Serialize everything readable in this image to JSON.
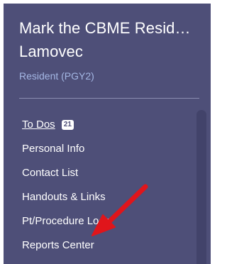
{
  "user": {
    "name_line1": "Mark the CBME Resid…",
    "name_line2": "Lamovec",
    "role": "Resident (PGY2)"
  },
  "menu": {
    "items": [
      {
        "label": "To Dos",
        "badge": "21",
        "active": true
      },
      {
        "label": "Personal Info"
      },
      {
        "label": "Contact List"
      },
      {
        "label": "Handouts & Links"
      },
      {
        "label": "Pt/Procedure Logs"
      },
      {
        "label": "Reports Center"
      }
    ]
  },
  "colors": {
    "panel_background": "#4e4f78",
    "role_text": "#a4b7e4",
    "annotation_arrow": "#e0151b"
  },
  "icons": {
    "annotation": "red-arrow-icon"
  }
}
